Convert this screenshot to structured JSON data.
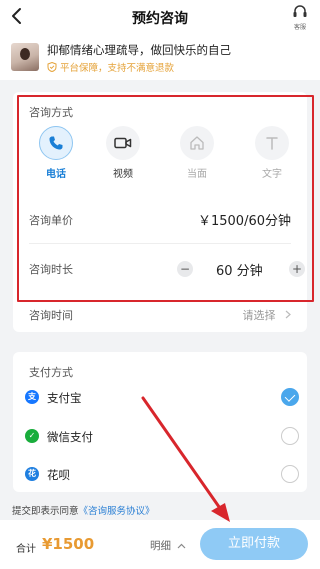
{
  "nav": {
    "back_icon": "chevron-left-icon",
    "title": "预约咨询",
    "service_icon": "headset-icon",
    "service_label": "客服"
  },
  "counselor": {
    "name": "抑郁情绪心理疏导，做回快乐的自己",
    "guarantee": "平台保障，支持不满意退款",
    "guarantee_icon": "shield-icon",
    "guarantee_color": "#e5a33a"
  },
  "consult": {
    "method_title": "咨询方式",
    "methods": [
      {
        "label": "电话",
        "icon": "phone-icon",
        "state": "active"
      },
      {
        "label": "视频",
        "icon": "video-icon",
        "state": "normal"
      },
      {
        "label": "当面",
        "icon": "home-icon",
        "state": "disabled"
      },
      {
        "label": "文字",
        "icon": "text-icon",
        "state": "disabled"
      }
    ],
    "price_label": "咨询单价",
    "price_value": "￥1500/60分钟",
    "duration_label": "咨询时长",
    "duration_value": "60 分钟",
    "minus": "−",
    "plus": "+",
    "time_label": "咨询时间",
    "time_placeholder": "请选择",
    "accent_color": "#1a7fd6",
    "highlight_border_color": "#d8262c"
  },
  "payment": {
    "title": "支付方式",
    "methods": [
      {
        "label": "支付宝",
        "icon": "alipay-icon",
        "checked": true
      },
      {
        "label": "微信支付",
        "icon": "wechat-pay-icon",
        "checked": false
      },
      {
        "label": "花呗",
        "icon": "huabei-icon",
        "checked": false
      }
    ]
  },
  "agreement": {
    "prefix": "提交即表示同意",
    "link": "《咨询服务协议》"
  },
  "footer": {
    "total_label": "合计",
    "total_amount": "¥1500",
    "detail_label": "明细",
    "pay_button": "立即付款",
    "pay_button_color": "#8fcaf5",
    "amount_color": "#e89a32"
  }
}
